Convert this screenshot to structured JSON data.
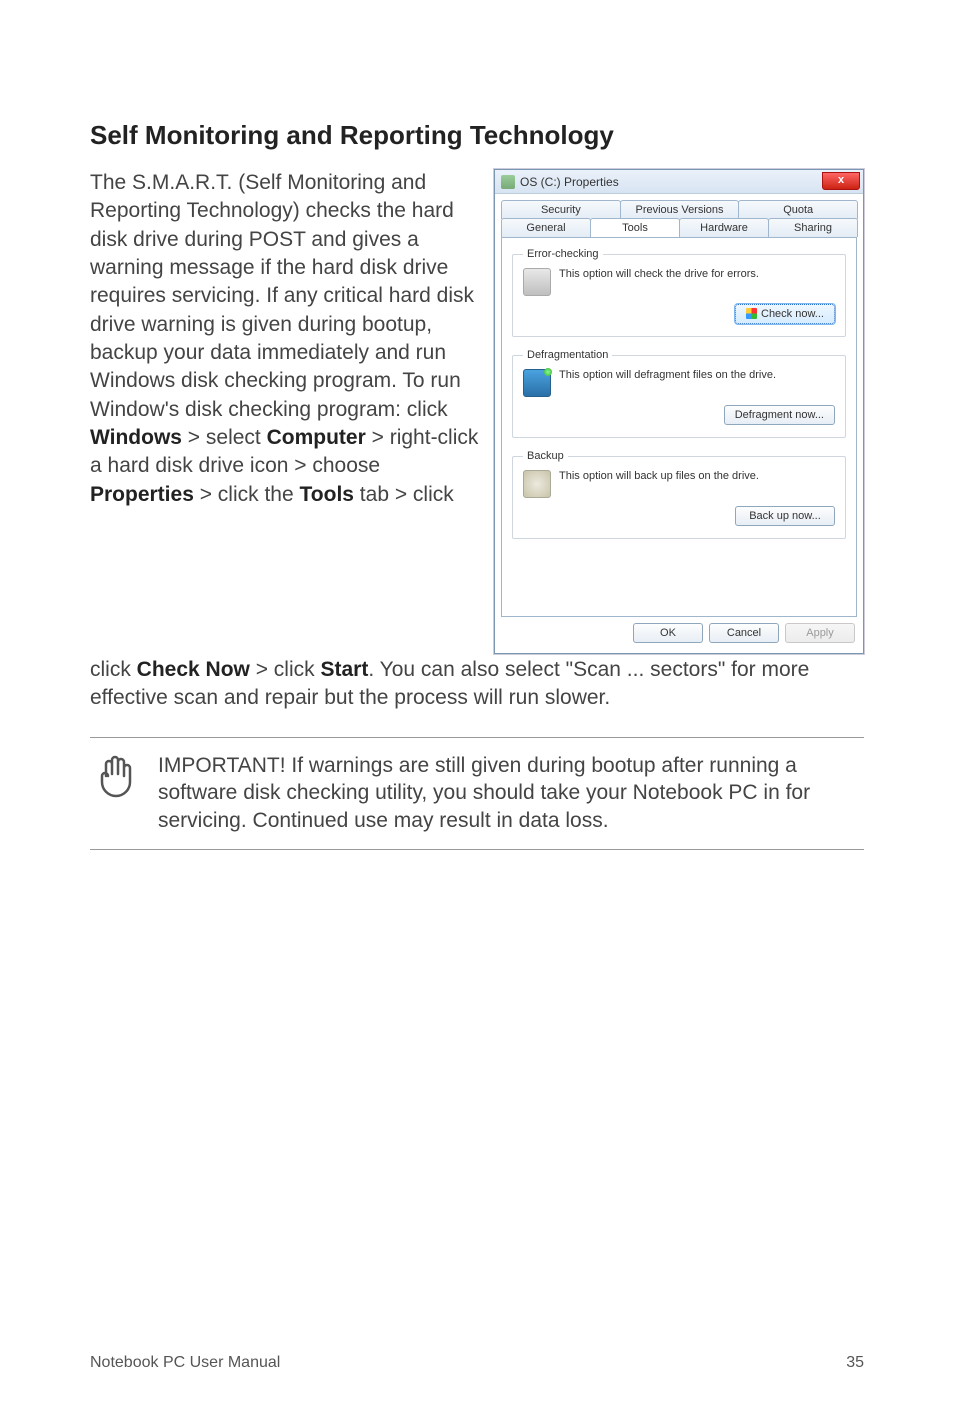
{
  "heading": "Self Monitoring and Reporting Technology",
  "para1_pre": "The S.M.A.R.T. (Self Monitoring and Reporting Technology) checks the hard disk drive during POST and gives a warning message if the hard disk drive requires servicing. If any critical hard disk drive warning is given during bootup, backup your data immediately and run Windows disk checking program. To run Window's disk checking program: click ",
  "w_windows": "Windows",
  "gt1": " > select ",
  "w_computer": "Computer",
  "t_right": " > right-click a hard disk drive icon > choose ",
  "w_properties": "Properties",
  "t_clicktools": " > click the ",
  "w_tools": "Tools",
  "t_tab": " tab > click ",
  "w_checknow": "Check Now",
  "t_clickstart": " > click ",
  "w_start": "Start",
  "t_rest": ". You can also select \"Scan ... sectors\" for more effective scan and repair but the process will run slower.",
  "note": "IMPORTANT! If warnings are still given during bootup after running a software disk checking utility, you should take your Notebook PC in for servicing. Continued use may result in data loss.",
  "footer_left": "Notebook PC User Manual",
  "footer_right": "35",
  "dialog": {
    "title": "OS (C:) Properties",
    "close": "x",
    "tabs_row1": [
      "Security",
      "Previous Versions",
      "Quota"
    ],
    "tabs_row2": [
      "General",
      "Tools",
      "Hardware",
      "Sharing"
    ],
    "group_error": {
      "legend": "Error-checking",
      "text": "This option will check the drive for errors.",
      "button": "Check now..."
    },
    "group_defrag": {
      "legend": "Defragmentation",
      "text": "This option will defragment files on the drive.",
      "button": "Defragment now..."
    },
    "group_backup": {
      "legend": "Backup",
      "text": "This option will back up files on the drive.",
      "button": "Back up now..."
    },
    "buttons": {
      "ok": "OK",
      "cancel": "Cancel",
      "apply": "Apply"
    }
  }
}
